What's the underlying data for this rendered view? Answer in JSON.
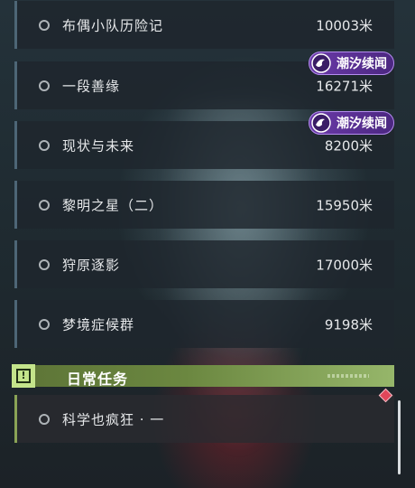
{
  "quests": [
    {
      "name": "布偶小队历险记",
      "distance": "10003米"
    },
    {
      "name": "一段善缘",
      "distance": "16271米",
      "tag": "潮汐续闻"
    },
    {
      "name": "现状与未来",
      "distance": "8200米",
      "tag": "潮汐续闻"
    },
    {
      "name": "黎明之星（二）",
      "distance": "15950米"
    },
    {
      "name": "狩原逐影",
      "distance": "17000米"
    },
    {
      "name": "梦境症候群",
      "distance": "9198米"
    }
  ],
  "daily_section": {
    "title": "日常任务",
    "icon": "exclamation-box-icon",
    "quests": [
      {
        "name": "科学也疯狂 · 一"
      }
    ]
  },
  "colors": {
    "tag_purple": "#6a3aa8",
    "daily_green": "#8aa356",
    "marker_red": "#e0465a"
  }
}
